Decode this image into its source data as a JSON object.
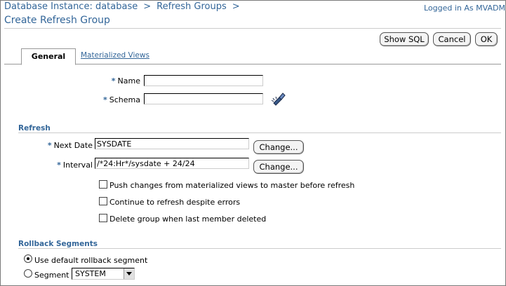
{
  "header": {
    "breadcrumb": [
      "Database Instance: database",
      "Refresh Groups"
    ],
    "breadcrumb_sep": ">",
    "title": "Create Refresh Group",
    "logged_in": "Logged in As MVADMIN"
  },
  "toolbar": {
    "show_sql": "Show SQL",
    "cancel": "Cancel",
    "ok": "OK"
  },
  "tabs": [
    {
      "label": "General",
      "active": true
    },
    {
      "label": "Materialized Views",
      "active": false
    }
  ],
  "general": {
    "name_label": "Name",
    "name_value": "",
    "schema_label": "Schema",
    "schema_value": "",
    "search_icon": "flashlight-icon"
  },
  "refresh": {
    "section_title": "Refresh",
    "next_date_label": "Next Date",
    "next_date_value": "SYSDATE",
    "interval_label": "Interval",
    "interval_value": "/*24:Hr*/sysdate + 24/24",
    "change_label": "Change...",
    "options": [
      {
        "label": "Push changes from materialized views to master before refresh",
        "checked": false
      },
      {
        "label": "Continue to refresh despite errors",
        "checked": false
      },
      {
        "label": "Delete group when last member deleted",
        "checked": false
      }
    ]
  },
  "rollback": {
    "section_title": "Rollback Segments",
    "default_label": "Use default rollback segment",
    "segment_label": "Segment",
    "segment_value": "SYSTEM",
    "selected": "default"
  },
  "colors": {
    "accent": "#336699",
    "required": "#336699"
  }
}
